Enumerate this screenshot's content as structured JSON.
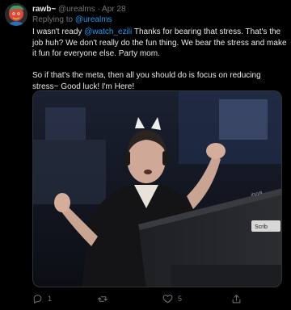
{
  "tweet": {
    "display_name": "rawb~",
    "handle": "@urealms",
    "separator": "·",
    "date": "Apr 28",
    "replying_to_label": "Replying to",
    "replying_to_handle": "@urealms",
    "paragraph1": {
      "prefix": "I wasn't ready ",
      "mention": "@watch_ezili",
      "suffix": " Thanks for bearing that stress. That's the job huh? We don't really do the fun thing. We bear the stress and make it fun for everyone else. Party mom."
    },
    "paragraph2": "So if that's the meta, then all you should do is focus on reducing stress~ Good luck! I'm Here!",
    "media": {
      "monitor_brand": "inyya",
      "overlay_text": "Scrib"
    },
    "actions": {
      "reply_count": "1",
      "retweet_count": "",
      "like_count": "5"
    }
  },
  "icons": {
    "reply": "reply-icon",
    "retweet": "retweet-icon",
    "like": "heart-icon",
    "share": "share-icon"
  },
  "colors": {
    "background": "#000000",
    "text": "#e7e9ea",
    "muted": "#71767b",
    "link": "#1d9bf0"
  }
}
